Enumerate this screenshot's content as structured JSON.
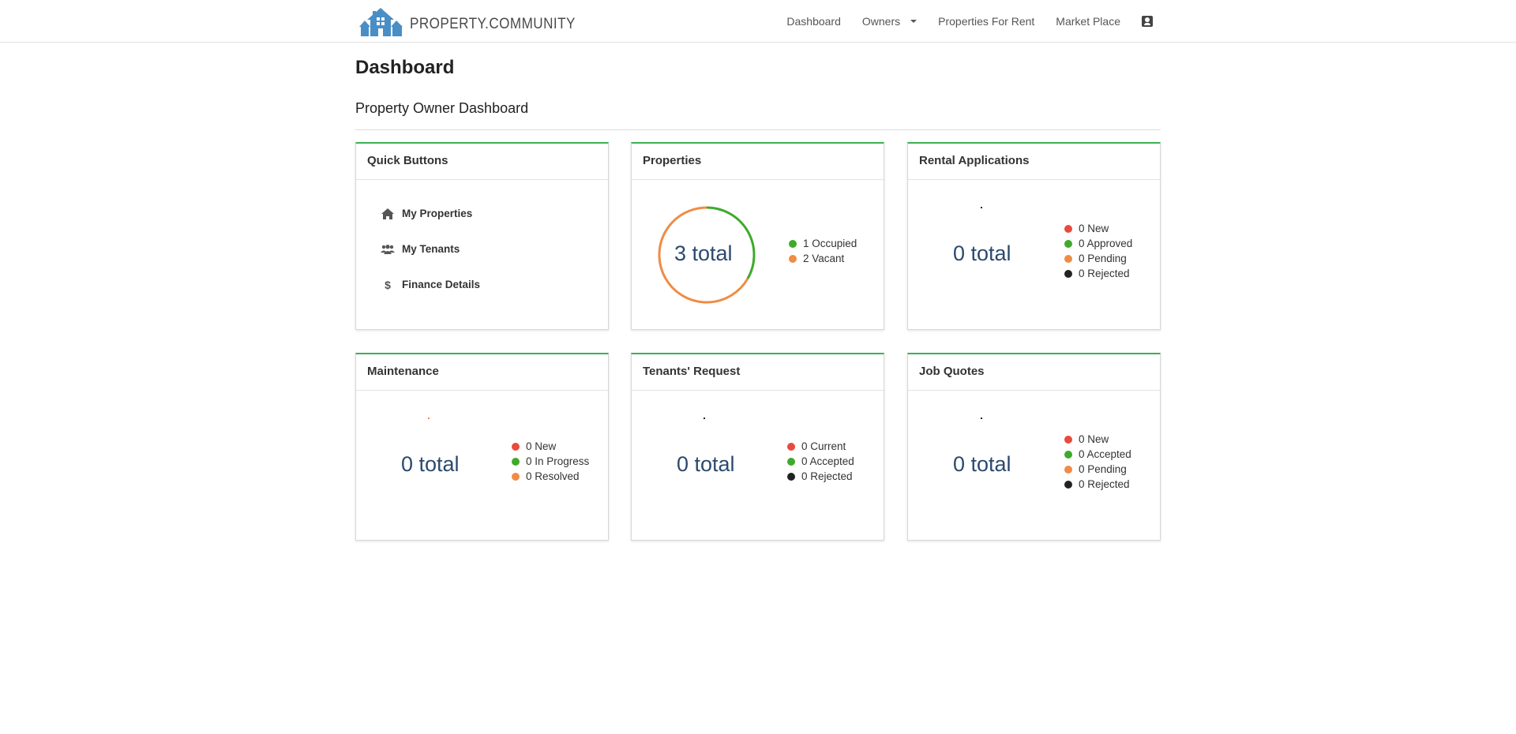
{
  "brand": {
    "name": "PROPERTY.COMMUNITY",
    "logo_icon": "house-logo-icon",
    "logo_color": "#4a8ec6"
  },
  "nav": {
    "links": [
      {
        "label": "Dashboard"
      },
      {
        "label": "Owners",
        "has_dropdown": true
      },
      {
        "label": "Properties For Rent"
      },
      {
        "label": "Market Place"
      }
    ],
    "profile_icon": "user-card-icon"
  },
  "page": {
    "title": "Dashboard",
    "subtitle": "Property Owner Dashboard"
  },
  "colors": {
    "accent_green": "#3cb054",
    "red": "#e84a3e",
    "green": "#3faa2a",
    "orange": "#ef8c45",
    "dark": "#222222",
    "total_text": "#2b4a6e"
  },
  "quick_buttons": {
    "title": "Quick Buttons",
    "items": [
      {
        "label": "My Properties",
        "icon": "home-icon"
      },
      {
        "label": "My Tenants",
        "icon": "users-icon"
      },
      {
        "label": "Finance Details",
        "icon": "dollar-icon"
      }
    ]
  },
  "properties": {
    "title": "Properties",
    "total": "3 total",
    "legend": [
      {
        "label": "1 Occupied",
        "value": 1
      },
      {
        "label": "2 Vacant",
        "value": 2
      }
    ]
  },
  "rental_applications": {
    "title": "Rental Applications",
    "total": "0 total",
    "legend": [
      {
        "label": "0 New"
      },
      {
        "label": "0 Approved"
      },
      {
        "label": "0 Pending"
      },
      {
        "label": "0 Rejected"
      }
    ]
  },
  "maintenance": {
    "title": "Maintenance",
    "total": "0 total",
    "legend": [
      {
        "label": "0 New"
      },
      {
        "label": "0 In Progress"
      },
      {
        "label": "0 Resolved"
      }
    ]
  },
  "tenants_request": {
    "title": "Tenants' Request",
    "total": "0 total",
    "legend": [
      {
        "label": "0 Current"
      },
      {
        "label": "0 Accepted"
      },
      {
        "label": "0 Rejected"
      }
    ]
  },
  "job_quotes": {
    "title": "Job Quotes",
    "total": "0 total",
    "legend": [
      {
        "label": "0 New"
      },
      {
        "label": "0 Accepted"
      },
      {
        "label": "0 Pending"
      },
      {
        "label": "0 Rejected"
      }
    ]
  }
}
